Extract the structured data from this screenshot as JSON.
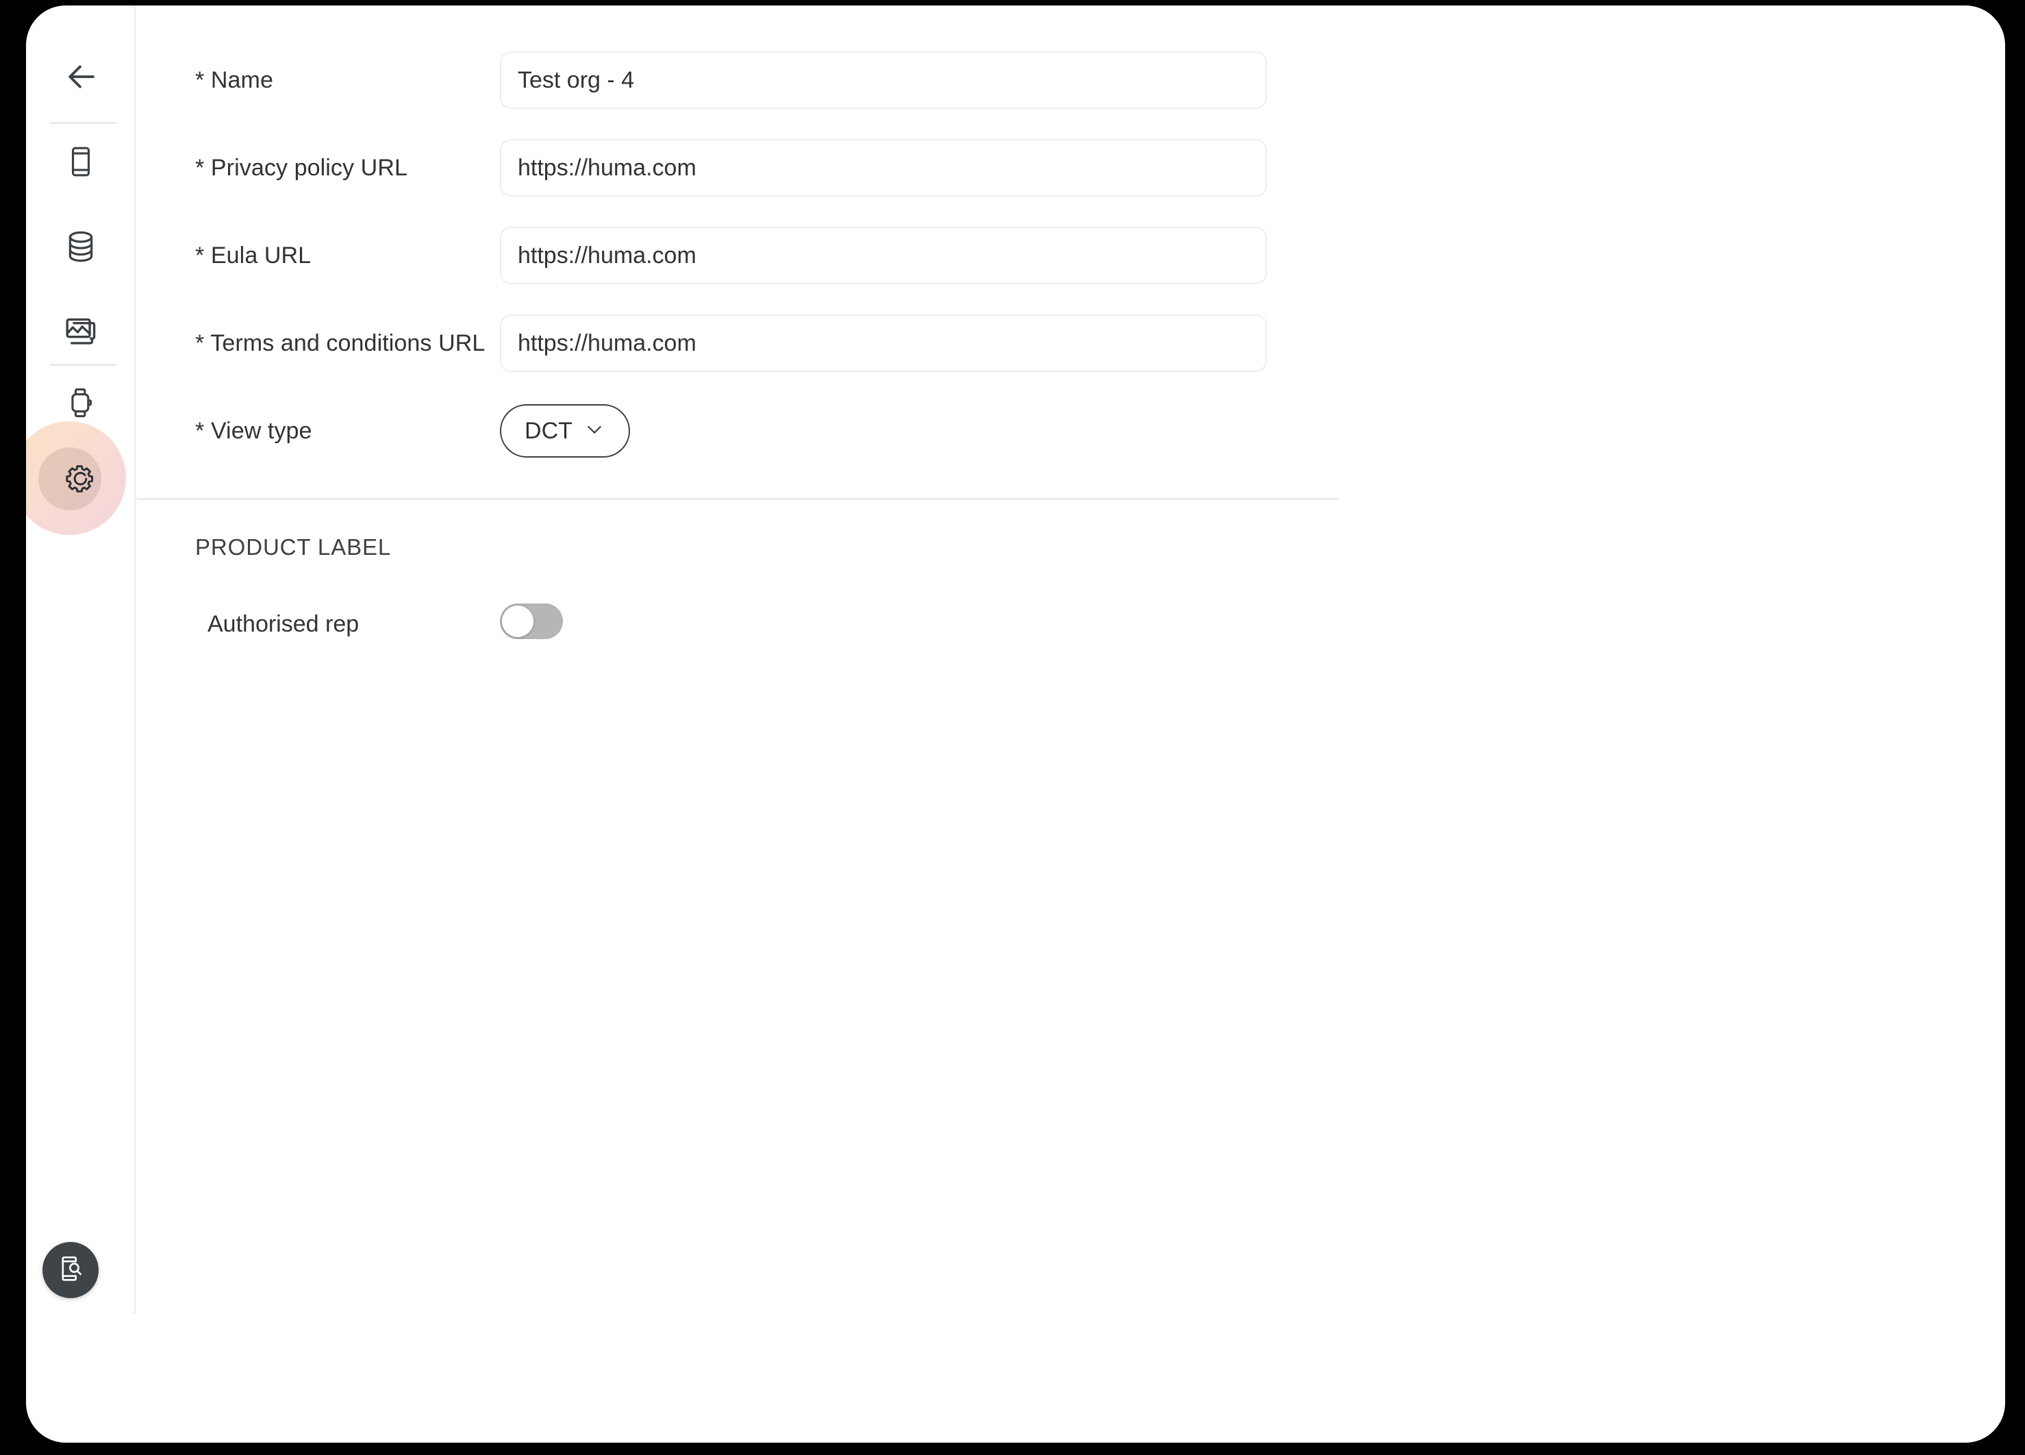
{
  "sidebar": {
    "back_button": {
      "icon": "arrow-left-icon",
      "label": "Back"
    },
    "items": [
      {
        "id": "mobile",
        "icon": "mobile-phone-icon",
        "label": "Mobile",
        "active": false
      },
      {
        "id": "data",
        "icon": "database-icon",
        "label": "Data",
        "active": false
      },
      {
        "id": "media",
        "icon": "images-gallery-icon",
        "label": "Media",
        "active": false
      },
      {
        "id": "wearable",
        "icon": "smart-watch-icon",
        "label": "Wearable",
        "active": false
      },
      {
        "id": "settings",
        "icon": "gear-icon",
        "label": "Settings",
        "active": true
      }
    ],
    "preview_button": {
      "icon": "phone-preview-icon",
      "label": "Preview"
    },
    "active_highlight_color": "#f7d9c5",
    "active_highlight_color_2": "#f4d2d6",
    "preview_button_color": "#3f4448"
  },
  "form": {
    "fields": [
      {
        "label": "* Name",
        "value": "Test org - 4",
        "placeholder": "Name",
        "type": "text"
      },
      {
        "label": "* Privacy policy URL",
        "value": "https://huma.com",
        "placeholder": "Privacy policy URL",
        "type": "text"
      },
      {
        "label": "* Eula URL",
        "value": "https://huma.com",
        "placeholder": "Eula URL",
        "type": "text"
      },
      {
        "label": "* Terms and conditions URL",
        "value": "https://huma.com",
        "placeholder": "Terms and conditions URL",
        "type": "text"
      },
      {
        "label": "* View type",
        "value": "DCT",
        "type": "select",
        "options": [
          "DCT"
        ]
      }
    ]
  },
  "product_label_section": {
    "heading": "PRODUCT LABEL",
    "toggle": {
      "label": "Authorised rep",
      "state": "off",
      "track_color": "#b4b6b8",
      "knob_color": "#ffffff"
    }
  }
}
